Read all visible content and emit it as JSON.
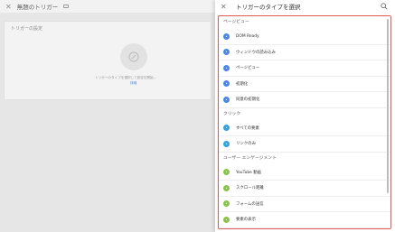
{
  "editor": {
    "title": "無題のトリガー",
    "card_title": "トリガーの設定",
    "hint": "トリガーのタイプを選択して設定を開始...",
    "link": "詳細"
  },
  "panel": {
    "title": "トリガーのタイプを選択"
  },
  "sections": [
    {
      "label": "ページビュー",
      "items": [
        {
          "label": "DOM Ready",
          "color": "#4a86e8",
          "icon": "document-icon"
        },
        {
          "label": "ウィンドウの読み込み",
          "color": "#4a86e8",
          "icon": "window-icon"
        },
        {
          "label": "ページビュー",
          "color": "#4a86e8",
          "icon": "eye-icon"
        },
        {
          "label": "初期化",
          "color": "#4a86e8",
          "icon": "power-icon"
        },
        {
          "label": "同意の初期化",
          "color": "#4a86e8",
          "icon": "shield-icon"
        }
      ]
    },
    {
      "label": "クリック",
      "items": [
        {
          "label": "すべての要素",
          "color": "#32a3e0",
          "icon": "cursor-icon"
        },
        {
          "label": "リンクのみ",
          "color": "#32a3e0",
          "icon": "link-icon"
        }
      ]
    },
    {
      "label": "ユーザー エンゲージメント",
      "items": [
        {
          "label": "YouTube 動画",
          "color": "#8bc34a",
          "icon": "play-icon"
        },
        {
          "label": "スクロール距離",
          "color": "#8bc34a",
          "icon": "scroll-icon"
        },
        {
          "label": "フォームの送信",
          "color": "#8bc34a",
          "icon": "form-icon"
        },
        {
          "label": "要素の表示",
          "color": "#8bc34a",
          "icon": "visibility-icon"
        }
      ]
    }
  ]
}
